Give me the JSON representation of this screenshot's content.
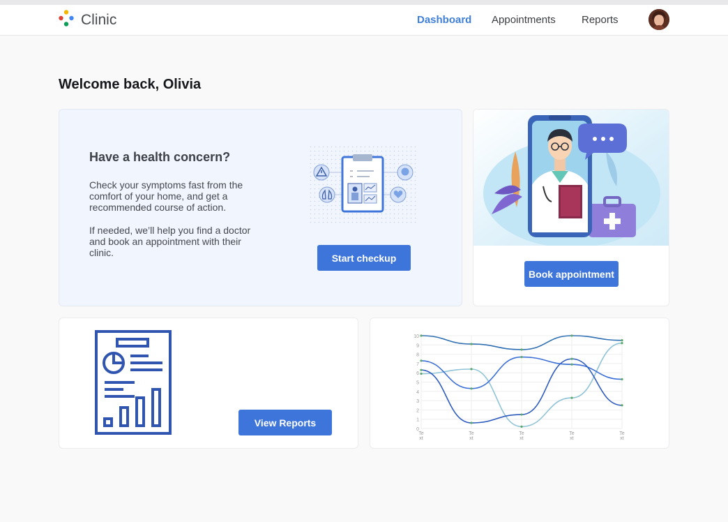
{
  "app": {
    "name": "Clinic"
  },
  "nav": {
    "items": [
      {
        "label": "Dashboard",
        "active": true
      },
      {
        "label": "Appointments",
        "active": false
      },
      {
        "label": "Reports",
        "active": false
      }
    ]
  },
  "welcome": "Welcome back, Olivia",
  "checkup": {
    "title": "Have a health concern?",
    "paragraph1": "Check your symptoms fast from the comfort of your home, and get a recommended course of action.",
    "paragraph2": "If needed, we’ll help you find a doctor and book an appointment with their clinic.",
    "button_label": "Start checkup"
  },
  "booking": {
    "button_label": "Book appointment"
  },
  "reports": {
    "button_label": "View Reports"
  },
  "colors": {
    "accent": "#3d75db",
    "nav_active": "#3f7fd8",
    "line_dark": "#2f6fb3",
    "line_blue": "#3c6fd6",
    "line_light": "#8fc3d6",
    "line_mid": "#2d5bbf"
  },
  "icons": [
    "clinic-logo-icon",
    "clipboard-icon",
    "warning-icon",
    "lungs-icon",
    "heart-icon",
    "report-document-icon",
    "doctor-phone-illustration"
  ],
  "chart_data": {
    "type": "line",
    "x": [
      "Text",
      "Text",
      "Text",
      "Text",
      "Text"
    ],
    "y_ticks": [
      "0",
      "1",
      "2",
      "3",
      "4",
      "5",
      "6",
      "7",
      "8",
      "9",
      "10"
    ],
    "ylim": [
      0,
      10
    ],
    "grid": true,
    "legend": "none",
    "series": [
      {
        "values": [
          10,
          9.1,
          8.5,
          10,
          9.5
        ]
      },
      {
        "values": [
          5.9,
          6.4,
          0.2,
          3.3,
          9.2
        ]
      },
      {
        "values": [
          7.3,
          4.3,
          7.7,
          6.9,
          5.3
        ]
      },
      {
        "values": [
          6.3,
          0.6,
          1.5,
          7.5,
          2.5
        ]
      }
    ]
  }
}
